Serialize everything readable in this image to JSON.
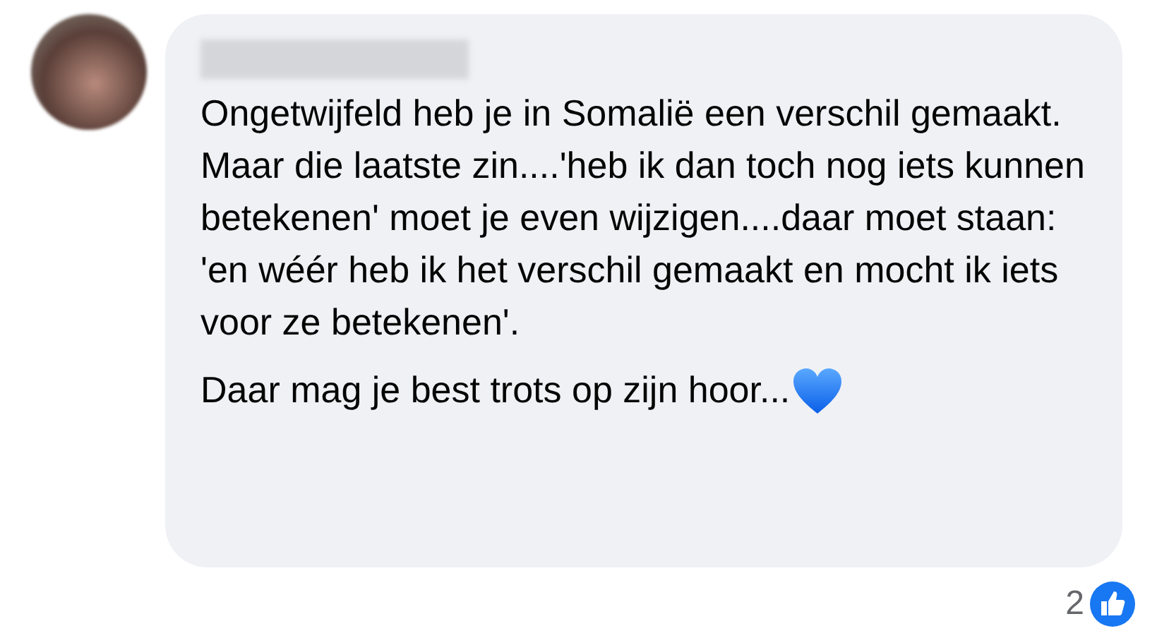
{
  "comment": {
    "paragraphs": [
      "Ongetwijfeld heb je in Somalië een verschil gemaakt.\nMaar die laatste zin....'heb ik dan toch nog iets kunnen betekenen' moet je even wijzigen....daar moet staan:  'en wéér heb ik het verschil gemaakt en mocht ik iets voor ze betekenen'.",
      "Daar mag je best trots op zijn hoor..."
    ],
    "reactions": {
      "count": "2"
    }
  }
}
